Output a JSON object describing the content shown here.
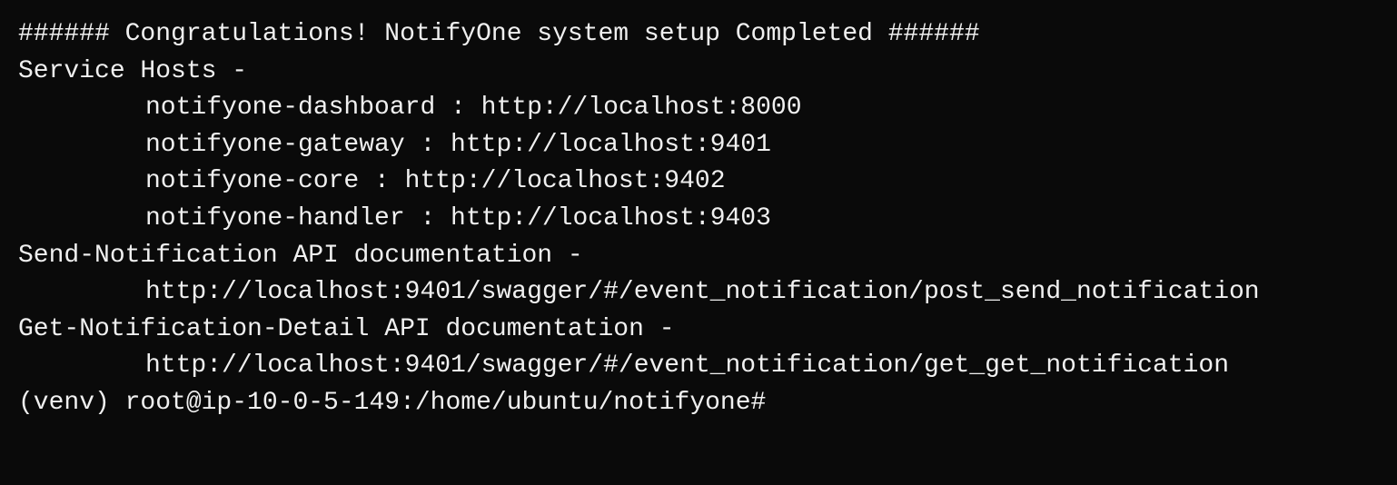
{
  "terminal": {
    "lines": [
      {
        "id": "header",
        "text": "###### Congratulations! NotifyOne system setup Completed ######",
        "indent": false
      },
      {
        "id": "service-hosts",
        "text": "Service Hosts -",
        "indent": false
      },
      {
        "id": "dashboard",
        "text": "notifyone-dashboard : http://localhost:8000",
        "indent": true
      },
      {
        "id": "gateway",
        "text": "notifyone-gateway : http://localhost:9401",
        "indent": true
      },
      {
        "id": "core",
        "text": "notifyone-core : http://localhost:9402",
        "indent": true
      },
      {
        "id": "handler",
        "text": "notifyone-handler : http://localhost:9403",
        "indent": true
      },
      {
        "id": "send-notification-label",
        "text": "Send-Notification API documentation -",
        "indent": false
      },
      {
        "id": "send-notification-url",
        "text": "http://localhost:9401/swagger/#/event_notification/post_send_notification",
        "indent": true
      },
      {
        "id": "get-notification-label",
        "text": "Get-Notification-Detail API documentation -",
        "indent": false
      },
      {
        "id": "get-notification-url",
        "text": "http://localhost:9401/swagger/#/event_notification/get_get_notification",
        "indent": true
      },
      {
        "id": "prompt",
        "text": "(venv) root@ip-10-0-5-149:/home/ubuntu/notifyone#",
        "indent": false,
        "hascursor": true
      }
    ]
  }
}
